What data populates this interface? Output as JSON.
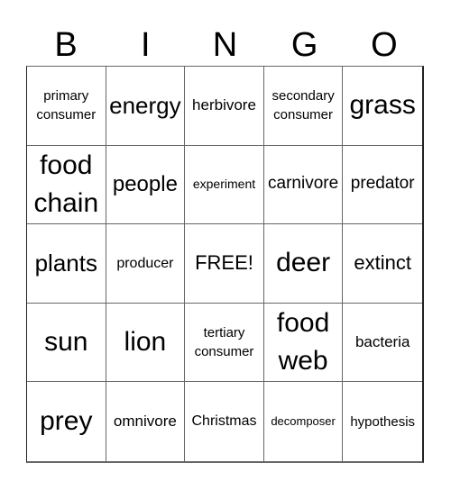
{
  "header": {
    "letters": [
      "B",
      "I",
      "N",
      "G",
      "O"
    ]
  },
  "cells": [
    "primary consumer",
    "energy",
    "herbivore",
    "secondary consumer",
    "grass",
    "food chain",
    "people",
    "experiment",
    "carnivore",
    "predator",
    "plants",
    "producer",
    "FREE!",
    "deer",
    "extinct",
    "sun",
    "lion",
    "tertiary consumer",
    "food web",
    "bacteria",
    "prey",
    "omnivore",
    "Christmas",
    "decomposer",
    "hypothesis"
  ]
}
